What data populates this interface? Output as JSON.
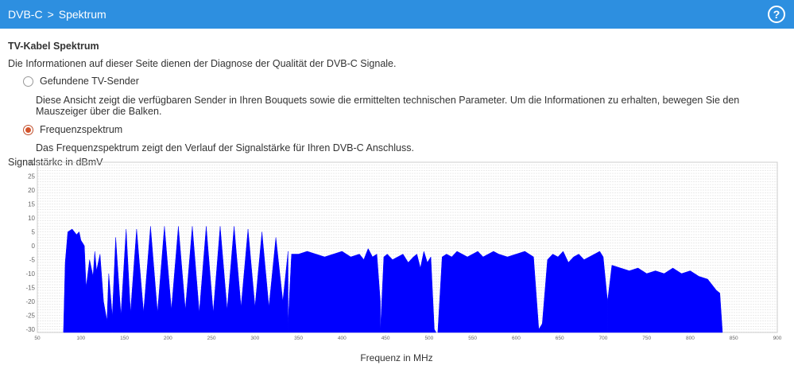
{
  "breadcrumb": {
    "parent": "DVB-C",
    "separator": ">",
    "current": "Spektrum"
  },
  "help": {
    "label": "?"
  },
  "section_title": "TV-Kabel Spektrum",
  "intro": "Die Informationen auf dieser Seite dienen der Diagnose der Qualität der DVB-C Signale.",
  "options": [
    {
      "label": "Gefundene TV-Sender",
      "selected": false,
      "description": "Diese Ansicht zeigt die verfügbaren Sender in Ihren Bouquets sowie die ermittelten technischen Parameter. Um die Informationen zu erhalten, bewegen Sie den Mauszeiger über die Balken."
    },
    {
      "label": "Frequenzspektrum",
      "selected": true,
      "description": "Das Frequenzspektrum zeigt den Verlauf der Signalstärke für Ihren DVB-C Anschluss."
    }
  ],
  "colors": {
    "bar": "#2d8fe0",
    "fill": "#0000ff",
    "radio_selected": "#d4542b"
  },
  "chart_data": {
    "type": "area",
    "ylabel": "Signalstärke in dBmV",
    "xlabel": "Frequenz in MHz",
    "xlim": [
      50,
      900
    ],
    "ylim": [
      -32,
      30
    ],
    "xticks": [
      50,
      100,
      150,
      200,
      250,
      300,
      350,
      400,
      450,
      500,
      550,
      600,
      650,
      700,
      750,
      800,
      850,
      900
    ],
    "yticks": [
      30,
      25,
      20,
      15,
      10,
      5,
      0,
      -5,
      -10,
      -15,
      -20,
      -25,
      -30
    ],
    "grid": true,
    "segments": [
      {
        "x": [
          80,
          82,
          85,
          90,
          95,
          98,
          100,
          104,
          106,
          110,
          114,
          116,
          118,
          122,
          126,
          130,
          132,
          136
        ],
        "y": [
          -32,
          -6,
          5,
          6,
          4,
          5,
          2,
          0,
          -15,
          -5,
          -11,
          -2,
          -9,
          -3,
          -20,
          -27,
          -10,
          -25
        ]
      },
      {
        "x": [
          136,
          140,
          146,
          152,
          157,
          164,
          172,
          180,
          188,
          196,
          204,
          212,
          220,
          228,
          236,
          244,
          252,
          260,
          268,
          276,
          284,
          292,
          300,
          308,
          316,
          324,
          332,
          338
        ],
        "y": [
          -26,
          3,
          -25,
          6,
          -24,
          6,
          -24,
          7,
          -24,
          7,
          -23,
          7,
          -23,
          7,
          -24,
          7,
          -24,
          7,
          -23,
          7,
          -22,
          6,
          -22,
          5,
          -22,
          3,
          -20,
          -2
        ]
      },
      {
        "x": [
          338,
          342,
          350,
          360,
          370,
          380,
          390,
          400,
          410,
          420,
          425,
          430,
          435,
          440,
          444
        ],
        "y": [
          -28,
          -3,
          -3,
          -2,
          -3,
          -4,
          -3,
          -2,
          -4,
          -3,
          -5,
          -1,
          -4,
          -3,
          -20
        ]
      },
      {
        "x": [
          444,
          448,
          452,
          458,
          464,
          470,
          476,
          482,
          486,
          490,
          494,
          498,
          502,
          506,
          508
        ],
        "y": [
          -32,
          -4,
          -3,
          -5,
          -4,
          -3,
          -6,
          -4,
          -3,
          -8,
          -2,
          -6,
          -4,
          -30,
          -32
        ]
      },
      {
        "x": [
          510,
          515,
          520,
          526,
          532,
          538,
          544,
          550,
          556,
          562,
          568,
          574,
          580,
          590,
          600,
          610,
          620,
          626,
          630
        ],
        "y": [
          -32,
          -4,
          -3,
          -4,
          -2,
          -3,
          -4,
          -3,
          -2,
          -4,
          -3,
          -2,
          -3,
          -4,
          -3,
          -2,
          -4,
          -30,
          -28
        ]
      },
      {
        "x": [
          630,
          636,
          642,
          648,
          654,
          660,
          666,
          672,
          678,
          684,
          690,
          696,
          700,
          705
        ],
        "y": [
          -28,
          -5,
          -3,
          -4,
          -2,
          -6,
          -4,
          -3,
          -5,
          -4,
          -3,
          -2,
          -4,
          -20
        ]
      },
      {
        "x": [
          705,
          710,
          720,
          730,
          740,
          750,
          760,
          770,
          780,
          790,
          800,
          810,
          820,
          830,
          834,
          837
        ],
        "y": [
          -20,
          -7,
          -8,
          -9,
          -8,
          -10,
          -9,
          -10,
          -8,
          -10,
          -9,
          -11,
          -12,
          -16,
          -17,
          -32
        ]
      }
    ]
  }
}
